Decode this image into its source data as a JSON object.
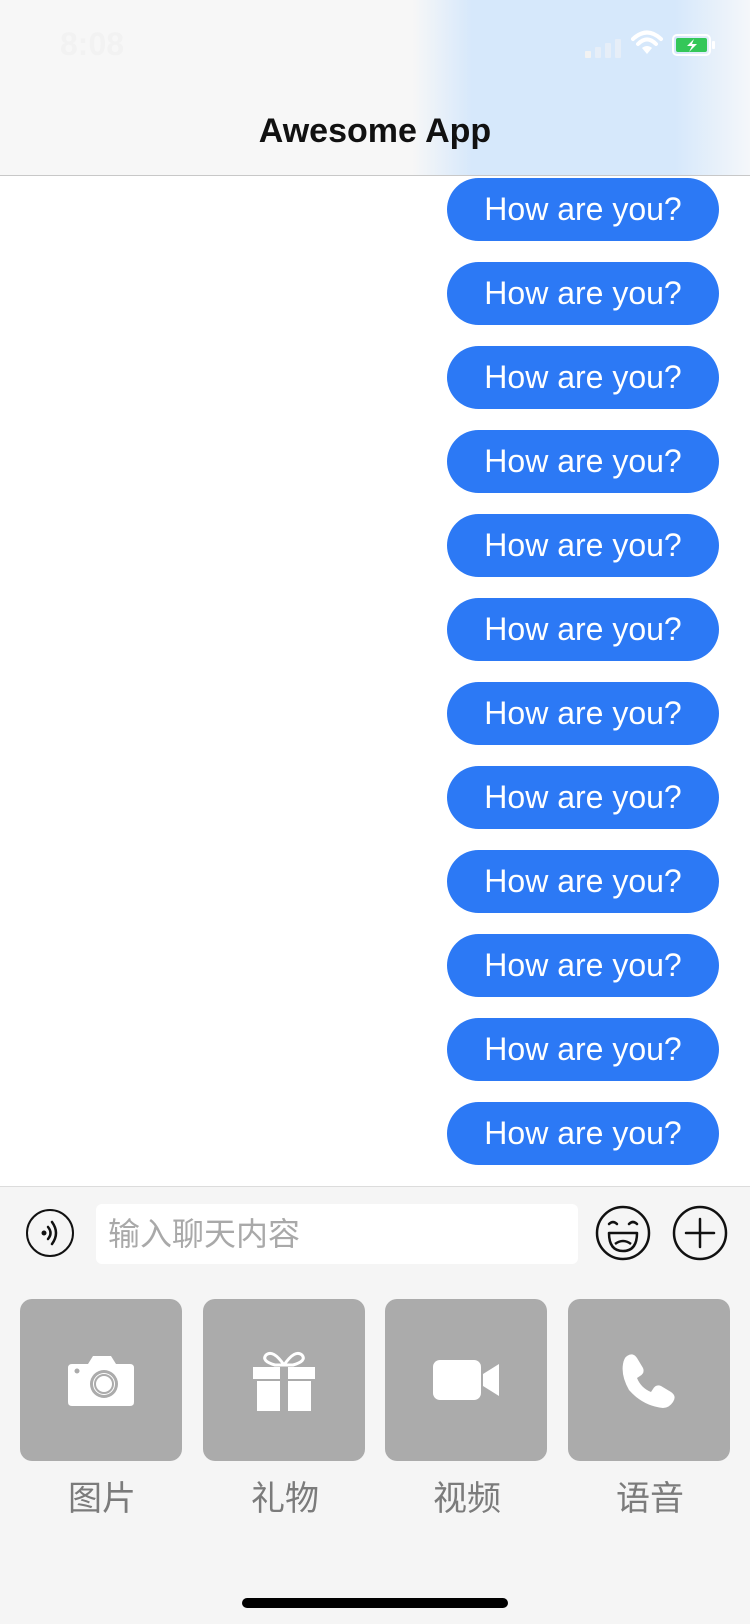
{
  "status_bar": {
    "time": "8:08",
    "signal_icon": "cellular-signal-icon",
    "wifi_icon": "wifi-icon",
    "battery_icon": "battery-charging-icon",
    "battery_color": "#34c759"
  },
  "nav": {
    "title": "Awesome App"
  },
  "messages": [
    {
      "text": "How are you?"
    },
    {
      "text": "How are you?"
    },
    {
      "text": "How are you?"
    },
    {
      "text": "How are you?"
    },
    {
      "text": "How are you?"
    },
    {
      "text": "How are you?"
    },
    {
      "text": "How are you?"
    },
    {
      "text": "How are you?"
    },
    {
      "text": "How are you?"
    },
    {
      "text": "How are you?"
    },
    {
      "text": "How are you?"
    },
    {
      "text": "How are you?"
    }
  ],
  "input_bar": {
    "voice_icon": "voice-icon",
    "placeholder": "输入聊天内容",
    "emoji_icon": "emoji-icon",
    "plus_icon": "plus-icon"
  },
  "actions": [
    {
      "label": "图片",
      "icon": "camera-icon"
    },
    {
      "label": "礼物",
      "icon": "gift-icon"
    },
    {
      "label": "视频",
      "icon": "video-camera-icon"
    },
    {
      "label": "语音",
      "icon": "phone-icon"
    }
  ],
  "colors": {
    "bubble": "#2c79f5",
    "tile": "#ababab",
    "panel": "#f5f5f5"
  }
}
